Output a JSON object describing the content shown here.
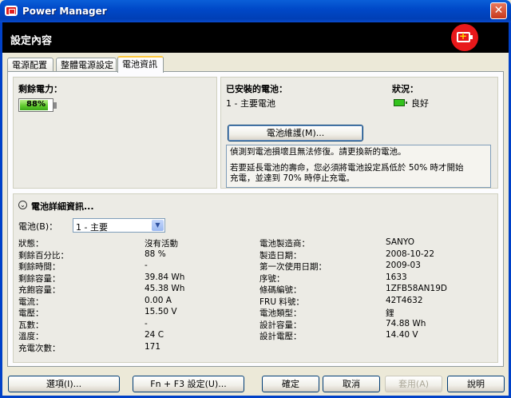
{
  "window": {
    "title": "Power Manager",
    "close_glyph": "✕"
  },
  "header": {
    "title": "設定內容",
    "badge_icon": "battery-charging-icon"
  },
  "tabs": [
    {
      "label": "電源配置"
    },
    {
      "label": "整體電源設定"
    },
    {
      "label": "電池資訊"
    }
  ],
  "remaining": {
    "label": "剩餘電力：",
    "percent_text": "88%",
    "percent_value": 0.88
  },
  "installed": {
    "label": "已安裝的電池：",
    "battery": "1 - 主要電池",
    "status_label": "狀況：",
    "status_value": "良好",
    "maintenance_button": "電池維護(M)...",
    "note_line1": "偵測到電池損壞且無法修復。請更換新的電池。",
    "note_line2": "若要延長電池的壽命，您必須將電池設定爲低於 50% 時才開始",
    "note_line3": "充電，並達到 70% 時停止充電。"
  },
  "details": {
    "title": "電池詳細資訊...",
    "battery_label": "電池(B)：",
    "battery_select": "1 - 主要",
    "left": [
      {
        "k": "狀態：",
        "v": "沒有活動"
      },
      {
        "k": "剩餘百分比：",
        "v": "88 %"
      },
      {
        "k": "剩餘時間：",
        "v": "-"
      },
      {
        "k": "剩餘容量：",
        "v": "39.84 Wh"
      },
      {
        "k": "充飽容量：",
        "v": "45.38 Wh"
      },
      {
        "k": "電流：",
        "v": "0.00 A"
      },
      {
        "k": "電壓：",
        "v": "15.50 V"
      },
      {
        "k": "瓦數：",
        "v": "-"
      },
      {
        "k": "溫度：",
        "v": "24 C"
      },
      {
        "k": "充電次數：",
        "v": "171"
      }
    ],
    "right": [
      {
        "k": "電池製造商：",
        "v": "SANYO"
      },
      {
        "k": "製造日期：",
        "v": "2008-10-22"
      },
      {
        "k": "第一次使用日期：",
        "v": "2009-03"
      },
      {
        "k": "序號：",
        "v": "1633"
      },
      {
        "k": "條碼編號：",
        "v": "1ZFB58AN19D"
      },
      {
        "k": "FRU 料號：",
        "v": "42T4632"
      },
      {
        "k": "電池類型：",
        "v": "鋰"
      },
      {
        "k": "設計容量：",
        "v": "74.88 Wh"
      },
      {
        "k": "設計電壓：",
        "v": "14.40 V"
      }
    ]
  },
  "buttons": {
    "options": "選項(I)...",
    "fn_f3": "Fn + F3 設定(U)...",
    "ok": "確定",
    "cancel": "取消",
    "apply": "套用(A)",
    "help": "說明"
  }
}
